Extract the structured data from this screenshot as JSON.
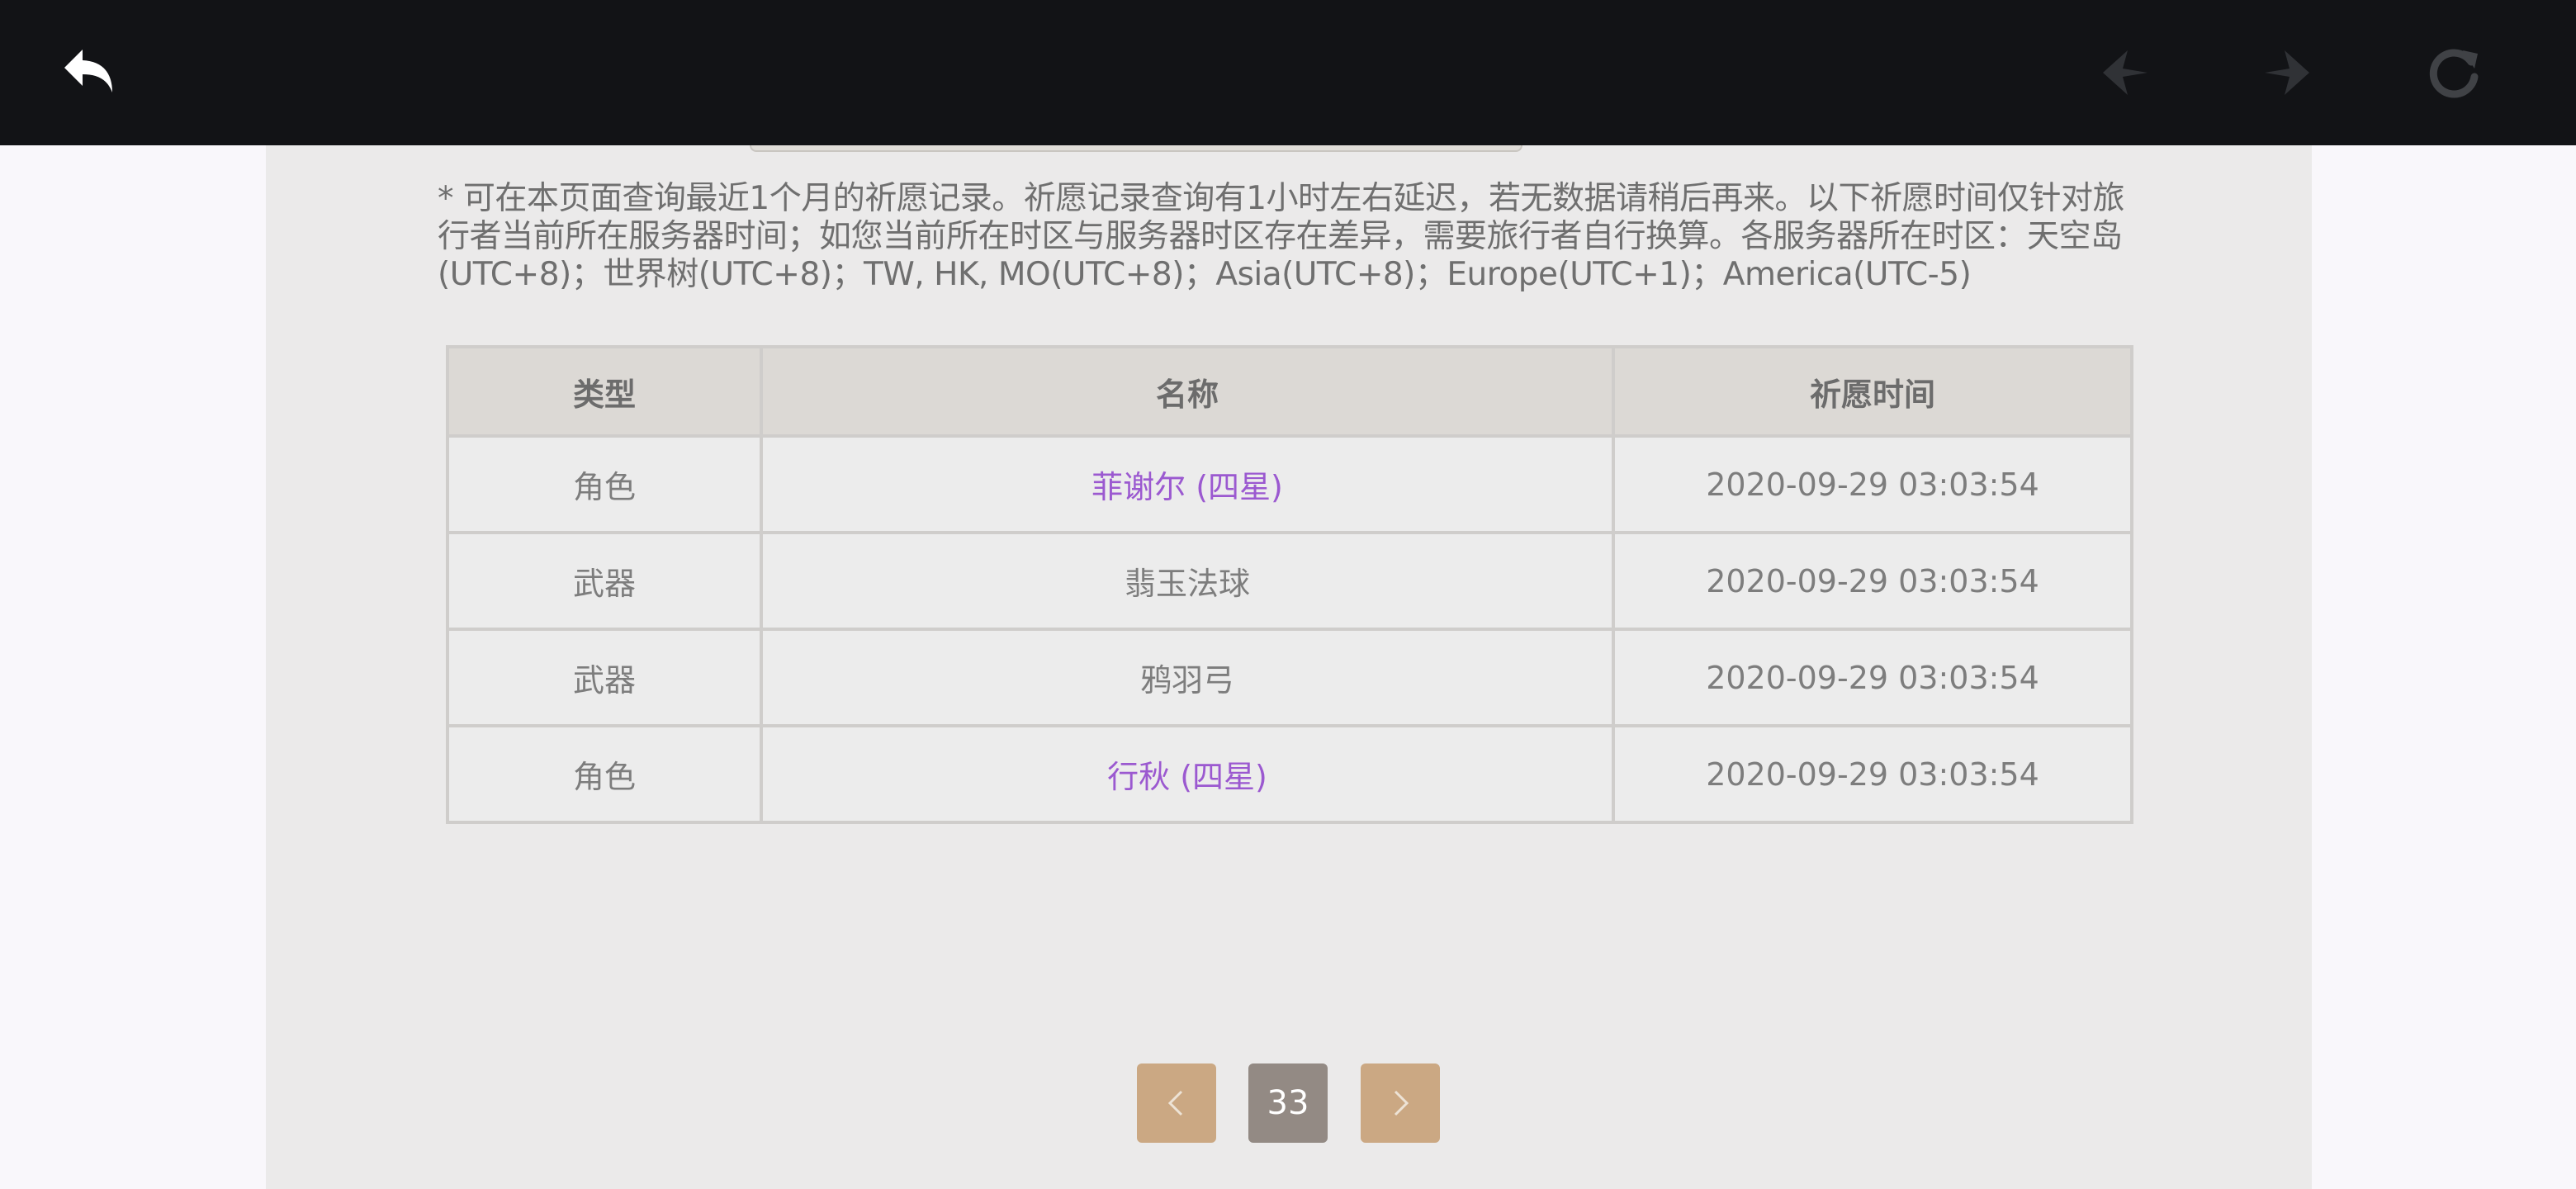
{
  "topbar": {
    "back_icon": "back-arrow-icon",
    "prev_icon": "nav-back-icon",
    "forward_icon": "nav-forward-icon",
    "refresh_icon": "refresh-icon"
  },
  "notice": "* 可在本页面查询最近1个月的祈愿记录。祈愿记录查询有1小时左右延迟，若无数据请稍后再来。以下祈愿时间仅针对旅行者当前所在服务器时间；如您当前所在时区与服务器时区存在差异，需要旅行者自行换算。各服务器所在时区：天空岛(UTC+8)；世界树(UTC+8)；TW, HK, MO(UTC+8)；Asia(UTC+8)；Europe(UTC+1)；America(UTC-5)",
  "table": {
    "headers": [
      "类型",
      "名称",
      "祈愿时间"
    ],
    "rows": [
      {
        "type": "角色",
        "name": "菲谢尔 (四星)",
        "time": "2020-09-29 03:03:54",
        "highlight": true
      },
      {
        "type": "武器",
        "name": "翡玉法球",
        "time": "2020-09-29 03:03:54",
        "highlight": false
      },
      {
        "type": "武器",
        "name": "鸦羽弓",
        "time": "2020-09-29 03:03:54",
        "highlight": false
      },
      {
        "type": "角色",
        "name": "行秋 (四星)",
        "time": "2020-09-29 03:03:54",
        "highlight": true
      }
    ]
  },
  "pagination": {
    "current_page": "33",
    "prev_icon": "chevron-left-icon",
    "next_icon": "chevron-right-icon"
  },
  "colors": {
    "topbar": "#121316",
    "panel": "#ebeaea",
    "four_star_purple": "#9b59d0",
    "pager_button": "#cba883",
    "pager_current": "#938a84"
  }
}
